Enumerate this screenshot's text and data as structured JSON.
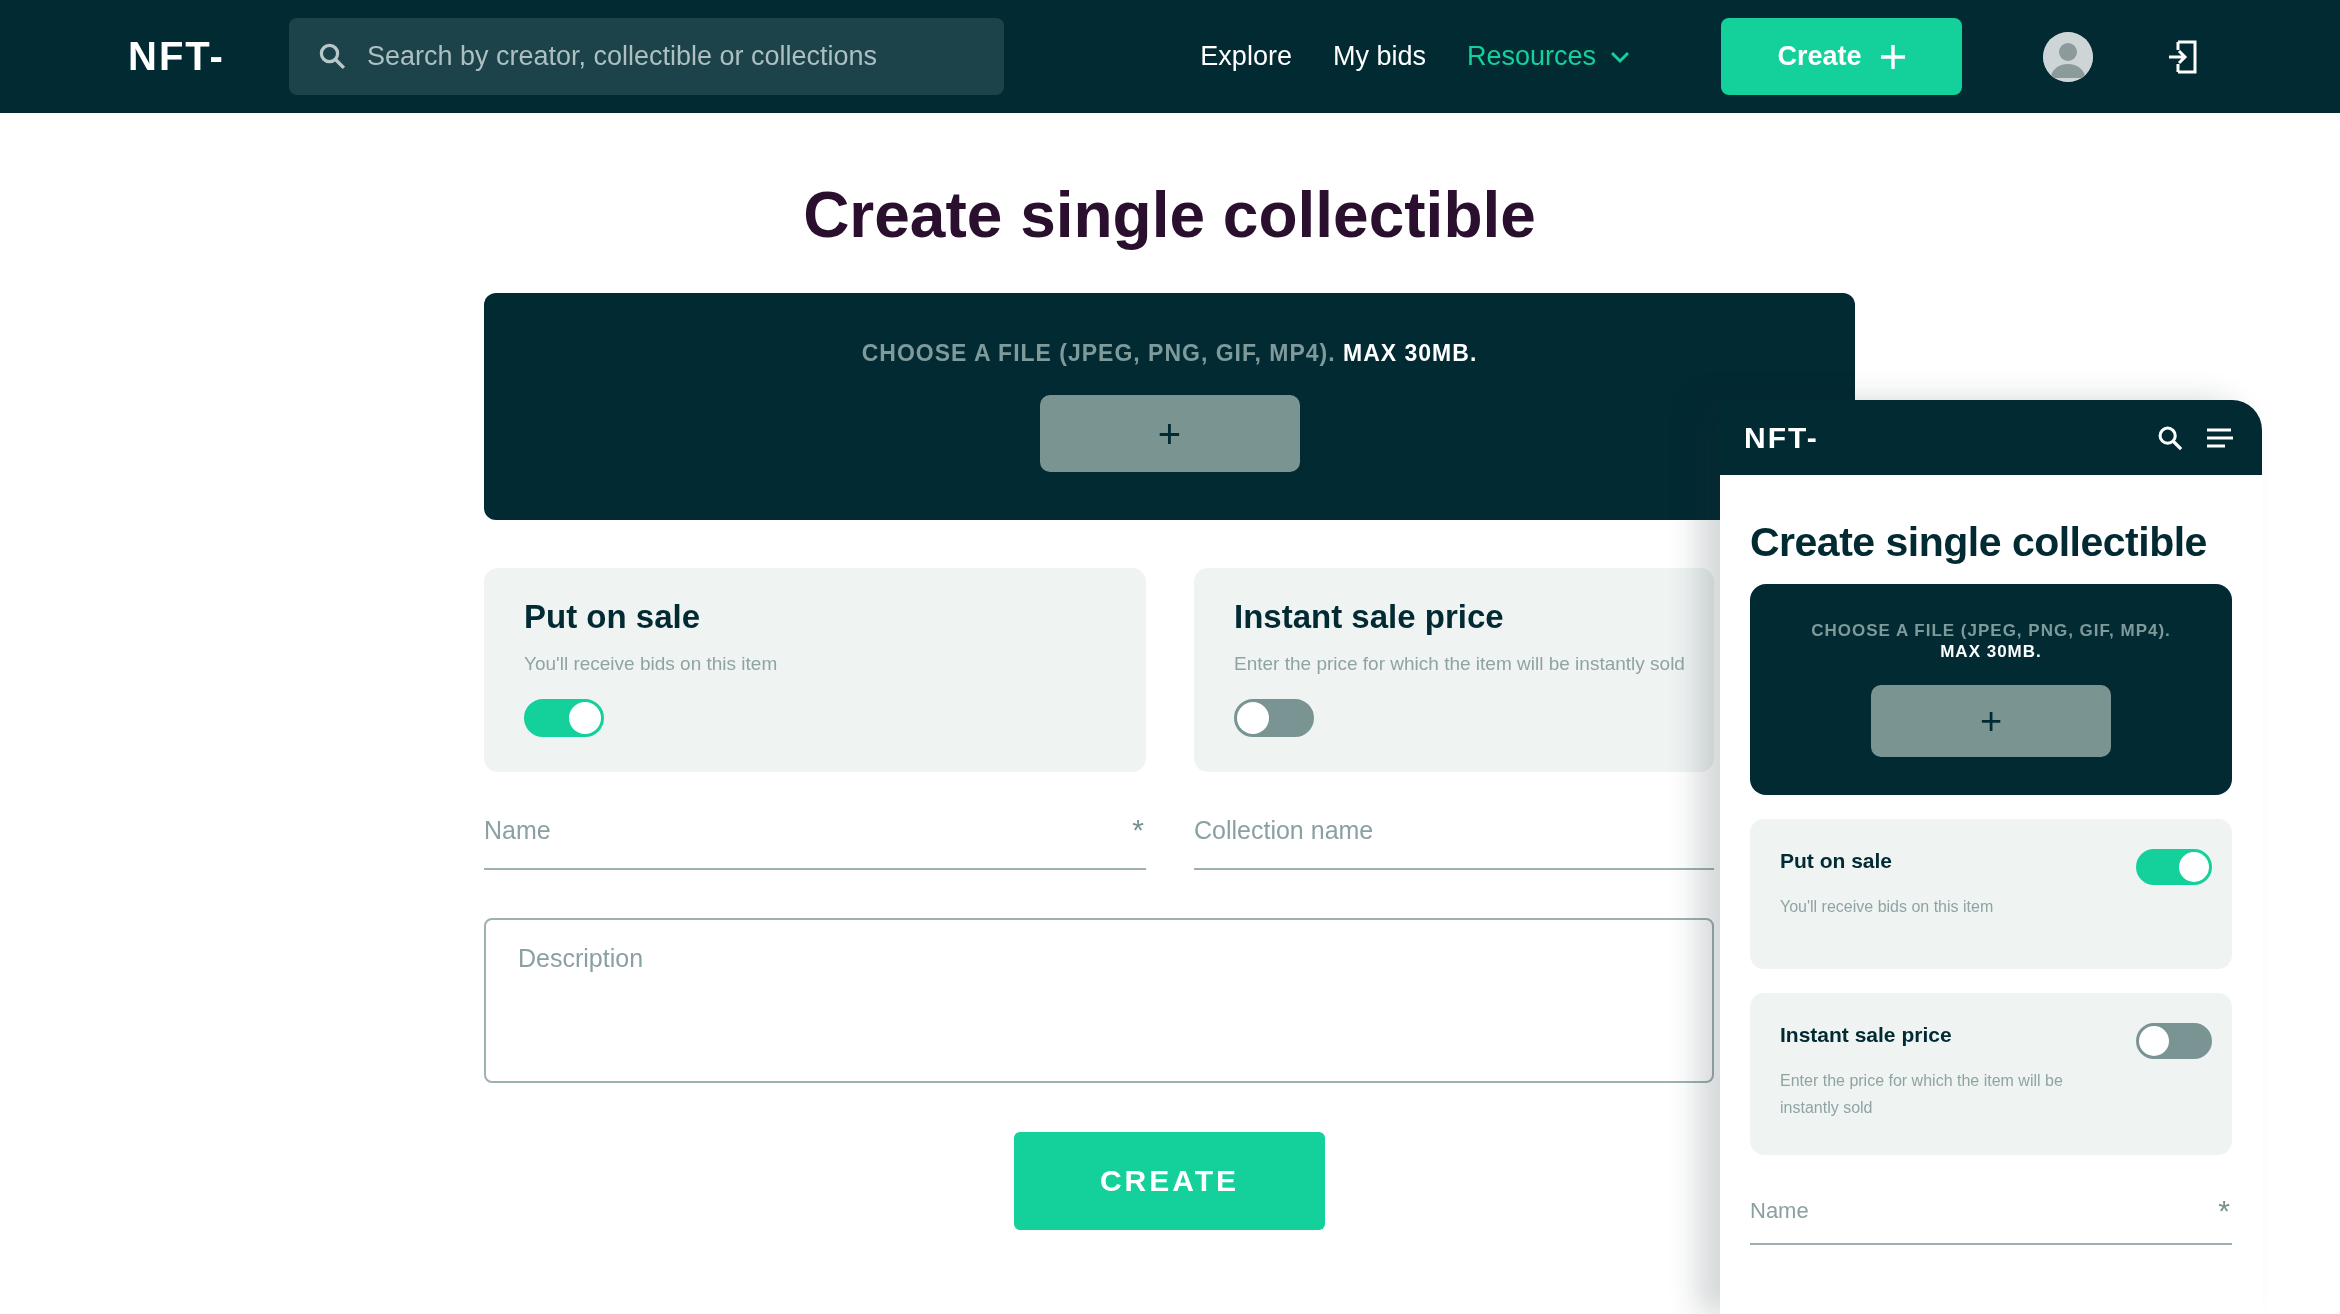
{
  "header": {
    "logo": "NFT-",
    "search": {
      "placeholder": "Search by creator, collectible or collections"
    },
    "nav": [
      {
        "label": "Explore",
        "selected": false
      },
      {
        "label": "My bids",
        "selected": false
      },
      {
        "label": "Resources",
        "selected": true
      }
    ],
    "create_button": "Create"
  },
  "title": "Create single collectible",
  "upload": {
    "hint": "CHOOSE A FILE (JPEG, PNG, GIF, MP4). **MAX 30MB.**",
    "button": "+"
  },
  "options": [
    {
      "title": "Put on sale",
      "description": "You'll receive bids on this item",
      "on": true
    },
    {
      "title": "Instant sale price",
      "description": "Enter the price for which the item will be instantly sold",
      "on": false
    }
  ],
  "fields": [
    {
      "placeholder": "Name",
      "required_mark": "*"
    },
    {
      "placeholder": "Collection name"
    }
  ],
  "description": {
    "placeholder": "Description"
  },
  "submit_button": "CREATE",
  "mobile": {
    "logo": "NFT-",
    "title": "Create single collectible",
    "upload": {
      "hint": "CHOOSE A FILE (JPEG, PNG, GIF, MP4). **MAX 30MB.**",
      "button": "+"
    },
    "options": [
      {
        "title": "Put on sale",
        "description": "You'll receive bids on this item",
        "on": true
      },
      {
        "title": "Instant sale price",
        "description": "Enter the price for which the item will be instantly sold",
        "on": false
      }
    ],
    "fields": [
      {
        "placeholder": "Name",
        "required_mark": "*"
      }
    ]
  }
}
